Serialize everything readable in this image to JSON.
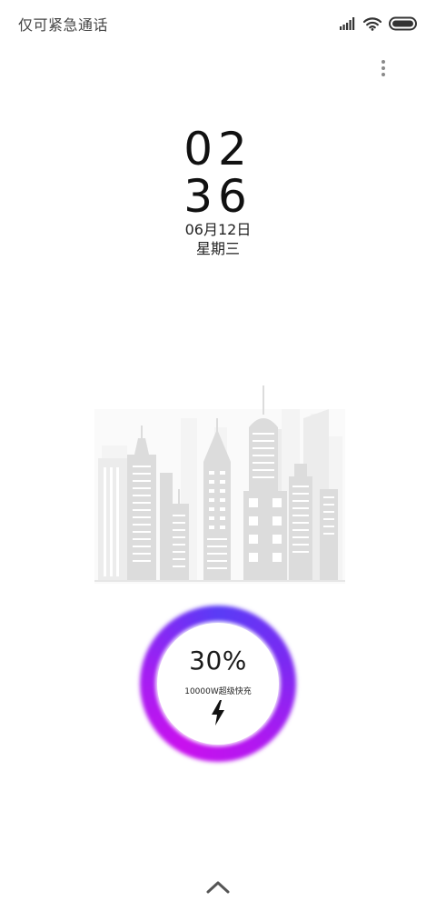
{
  "status_bar": {
    "carrier_text": "仅可紧急通话",
    "icons": [
      "signal-icon",
      "wifi-icon",
      "battery-icon"
    ]
  },
  "lock_screen": {
    "clock": {
      "hour": "02",
      "minute": "36"
    },
    "date": "06月12日",
    "weekday": "星期三"
  },
  "charging": {
    "percent_text": "30%",
    "level": 0.3,
    "mode_label": "10000W超级快充",
    "icon": "lightning-bolt-icon",
    "ring_colors": [
      "#5a3cf6",
      "#b317f0",
      "#c911ee"
    ]
  },
  "controls": {
    "menu_icon": "more-vertical-icon",
    "unlock_icon": "chevron-up-icon"
  }
}
